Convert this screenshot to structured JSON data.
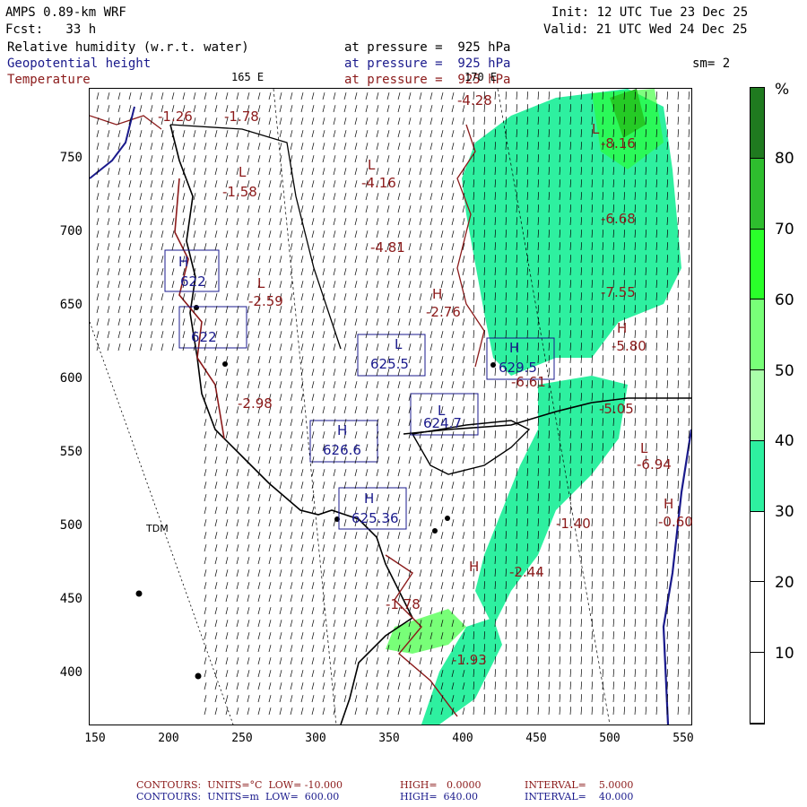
{
  "header": {
    "model": "AMPS 0.89-km WRF",
    "init": "Init: 12 UTC Tue 23 Dec 25",
    "fcst": "Fcst:   33 h",
    "valid": "Valid: 21 UTC Wed 24 Dec 25",
    "field1": "Relative humidity (w.r.t. water)",
    "field2": "Geopotential height",
    "field3": "Temperature",
    "level1": "at pressure =  925 hPa",
    "level2": "at pressure =  925 hPa",
    "level3": "at pressure =  925 hPa",
    "smooth": "sm= 2"
  },
  "map": {
    "lon_label_left": "165 E",
    "lon_label_right": "170 E",
    "station_label": "TDM",
    "x_ticks": [
      "150",
      "200",
      "250",
      "300",
      "350",
      "400",
      "450",
      "500",
      "550"
    ],
    "y_ticks": [
      "750",
      "700",
      "650",
      "600",
      "550",
      "500",
      "450",
      "400"
    ],
    "temp_labels": [
      "-1.26",
      "-1.78",
      "-4.28",
      "-8.16",
      "-1.58",
      "-4.16",
      "-6.68",
      "-4.81",
      "-2.59",
      "-2.76",
      "-7.55",
      "-5.80",
      "-6.61",
      "-2.98",
      "-5.05",
      "-6.94",
      "-0.60",
      "-1.40",
      "-2.44",
      "-1.78",
      "-1.93"
    ],
    "height_labels": [
      "622",
      "622",
      "625.5",
      "629.5",
      "624.7",
      "626.6",
      "625.36"
    ],
    "hl_markers": [
      "H",
      "L",
      "L",
      "L",
      "L",
      "H",
      "H",
      "H",
      "H",
      "H",
      "H",
      "H",
      "L",
      "L",
      "L"
    ]
  },
  "colorbar": {
    "unit": "%",
    "labels": [
      "80",
      "70",
      "60",
      "50",
      "40",
      "30",
      "20",
      "10"
    ],
    "colors": [
      "#1f7a1f",
      "#2ebd2e",
      "#2aff2a",
      "#78ff78",
      "#aaffaa",
      "#2ef0a0",
      "#ffffff",
      "#ffffff",
      "#ffffff"
    ]
  },
  "footer": {
    "line1_a": "CONTOURS:  UNITS=°C  LOW= -10.000",
    "line1_b": "HIGH=   0.0000",
    "line1_c": "INTERVAL=    5.0000",
    "line2_a": "CONTOURS:  UNITS=m  LOW=  600.00",
    "line2_b": "HIGH=  640.00",
    "line2_c": "INTERVAL=    40.000"
  }
}
